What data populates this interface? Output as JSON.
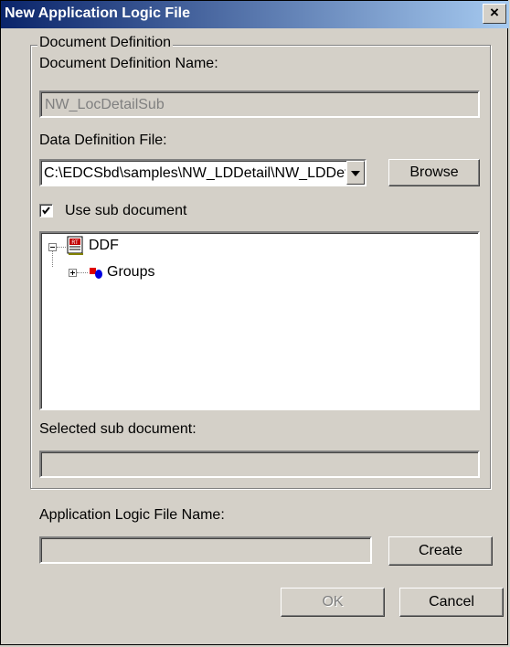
{
  "window": {
    "title": "New Application Logic File",
    "close_glyph": "×"
  },
  "document_definition": {
    "group_label": "Document Definition",
    "name_label": "Document Definition Name:",
    "name_value": "NW_LocDetailSub",
    "data_file_label": "Data Definition File:",
    "data_file_value": "C:\\EDCSbd\\samples\\NW_LDDetail\\NW_LDDetail",
    "browse_label": "Browse",
    "use_sub_label": "Use sub document",
    "use_sub_checked": true,
    "tree": {
      "root_label": "DDF",
      "child_label": "Groups"
    },
    "selected_sub_label": "Selected sub document:",
    "selected_sub_value": ""
  },
  "app_logic": {
    "name_label": "Application Logic File Name:",
    "name_value": "",
    "create_label": "Create"
  },
  "footer": {
    "ok_label": "OK",
    "cancel_label": "Cancel"
  },
  "icons": {
    "close": "close-icon",
    "dropdown": "chevron-down-icon",
    "check": "check-icon",
    "ddf": "ddf-file-icon",
    "groups": "groups-icon"
  }
}
